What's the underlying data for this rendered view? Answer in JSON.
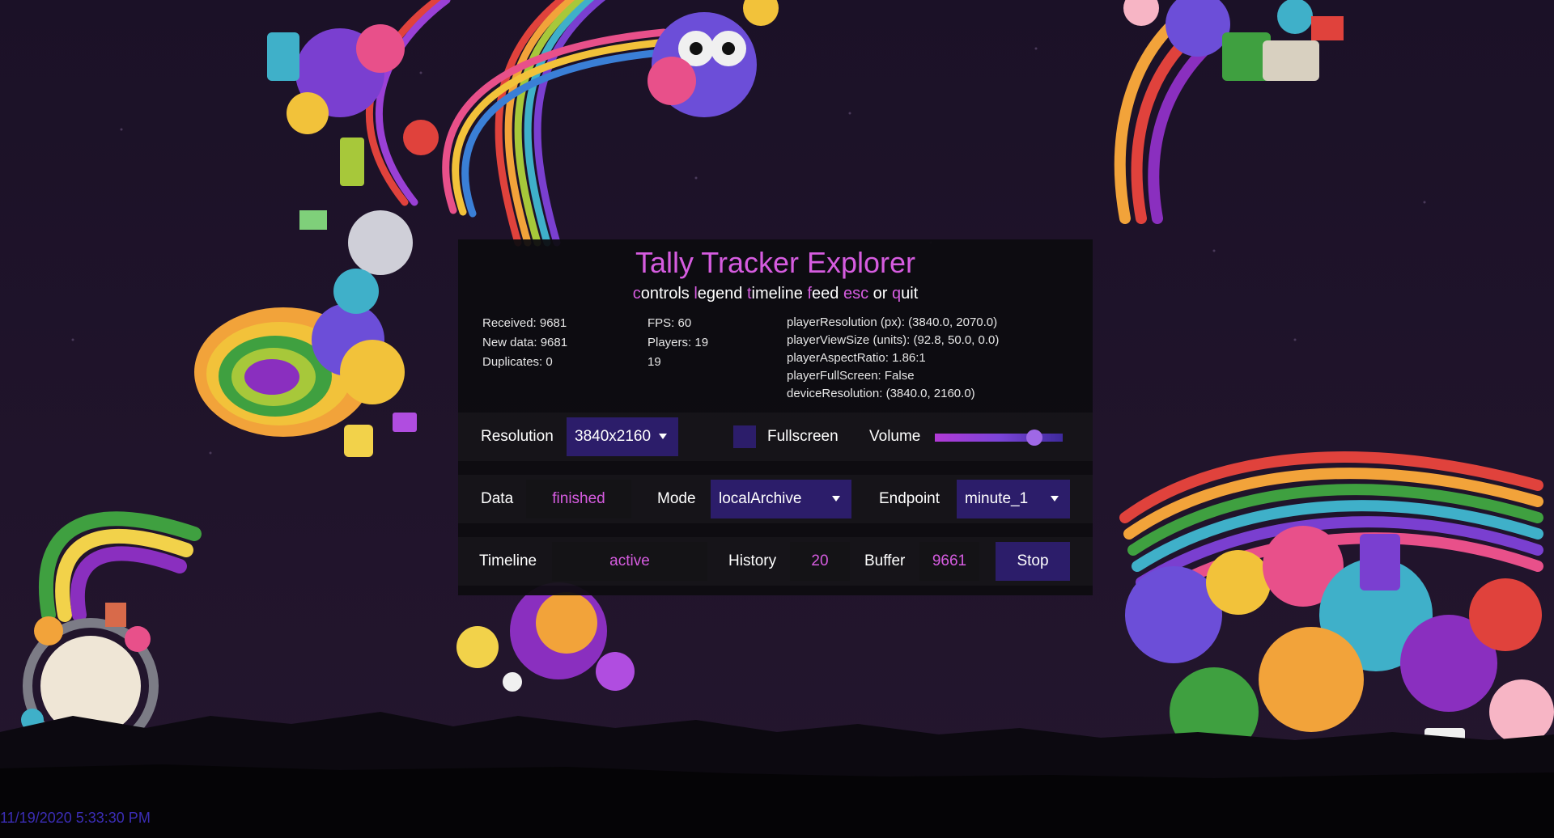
{
  "app": {
    "title": "Tally Tracker Explorer",
    "menu": [
      {
        "key": "c",
        "rest": "ontrols"
      },
      {
        "key": "l",
        "rest": "egend"
      },
      {
        "key": "t",
        "rest": "imeline"
      },
      {
        "key": "f",
        "rest": "eed"
      },
      {
        "key": "esc",
        "rest": ""
      },
      {
        "plain": "or"
      },
      {
        "key": "q",
        "rest": "uit"
      }
    ]
  },
  "stats": {
    "col1": [
      "Received: 9681",
      "New data: 9681",
      "Duplicates: 0"
    ],
    "col2": [
      "FPS: 60",
      "Players: 19",
      "19"
    ],
    "col3": [
      "playerResolution (px): (3840.0, 2070.0)",
      "playerViewSize (units): (92.8, 50.0, 0.0)",
      "playerAspectRatio: 1.86:1",
      "playerFullScreen: False",
      "deviceResolution: (3840.0, 2160.0)"
    ]
  },
  "controls": {
    "resolution_label": "Resolution",
    "resolution_value": "3840x2160",
    "fullscreen_label": "Fullscreen",
    "fullscreen_checked": false,
    "volume_label": "Volume",
    "volume_level": 0.78,
    "data_label": "Data",
    "data_value": "finished",
    "mode_label": "Mode",
    "mode_value": "localArchive",
    "endpoint_label": "Endpoint",
    "endpoint_value": "minute_1",
    "timeline_label": "Timeline",
    "timeline_value": "active",
    "history_label": "History",
    "history_value": "20",
    "buffer_label": "Buffer",
    "buffer_value": "9661",
    "stop_label": "Stop"
  },
  "footer": {
    "timestamp": "11/19/2020 5:33:30 PM"
  },
  "colors": {
    "accent": "#d65ce0",
    "control_bg": "#2c1d6a",
    "timestamp": "#3b2db5",
    "background": "#1a0f24"
  }
}
